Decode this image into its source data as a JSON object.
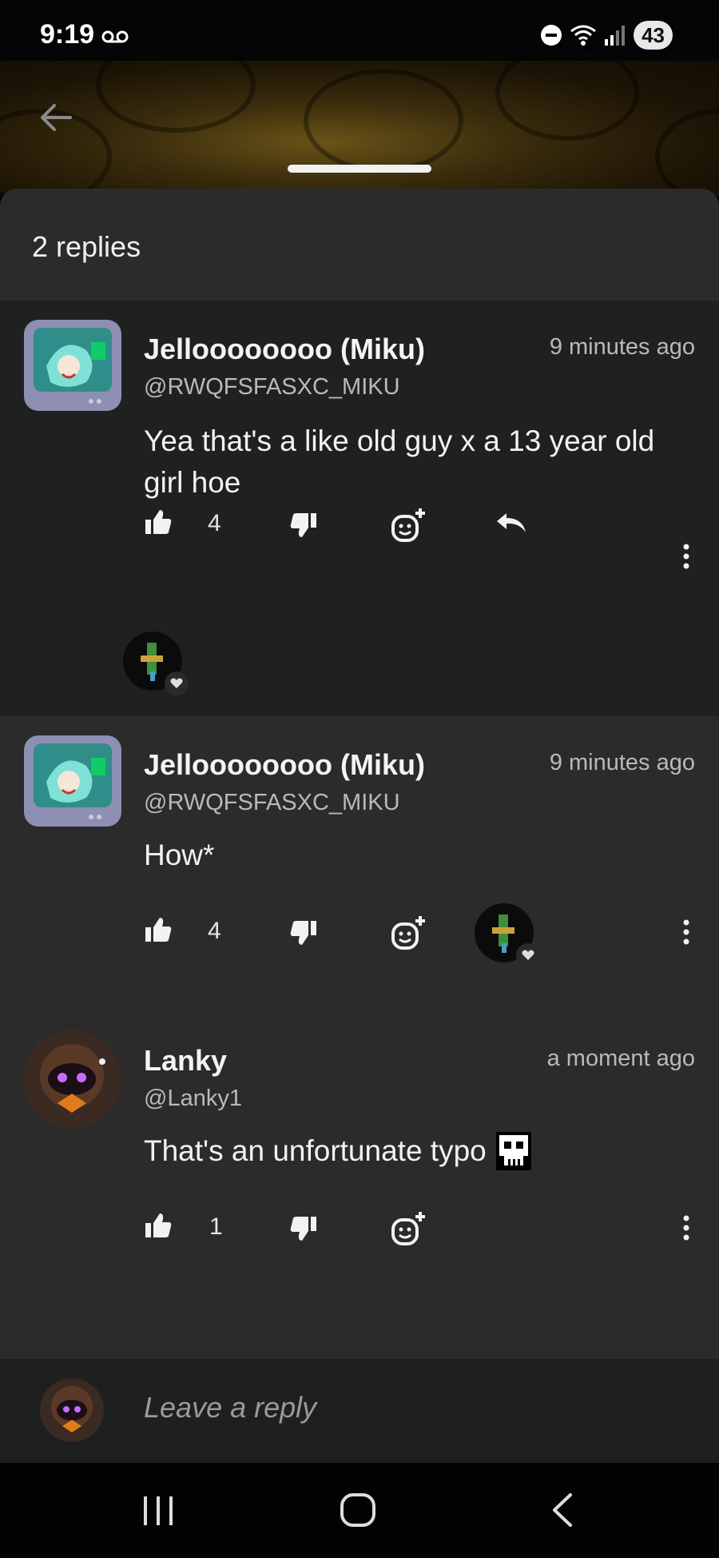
{
  "status_bar": {
    "time": "9:19",
    "battery": "43"
  },
  "sheet": {
    "title": "2 replies"
  },
  "parent_comment": {
    "author": "Jelloooooooo (Miku)",
    "handle": "@RWQFSFASXC_MIKU",
    "time": "9 minutes ago",
    "body": "Yea that's a like old guy x a 13 year old girl hoe",
    "likes": "4"
  },
  "replies": [
    {
      "author": "Jelloooooooo (Miku)",
      "handle": "@RWQFSFASXC_MIKU",
      "time": "9 minutes ago",
      "body": "How*",
      "likes": "4"
    },
    {
      "author": "Lanky",
      "handle": "@Lanky1",
      "time": "a moment ago",
      "body": "That's an unfortunate typo",
      "likes": "1"
    }
  ],
  "reply_bar": {
    "placeholder": "Leave a reply"
  },
  "icons": {
    "like": "thumbs-up-icon",
    "dislike": "thumbs-down-icon",
    "react": "add-reaction-icon",
    "reply": "reply-arrow-icon",
    "more": "more-vertical-icon",
    "skull": "skull-emoji-icon"
  },
  "colors": {
    "sheet_bg": "#2b2b2b",
    "parent_bg": "#1f2121",
    "text": "#f2f2f2",
    "muted": "#b9b9b9"
  }
}
